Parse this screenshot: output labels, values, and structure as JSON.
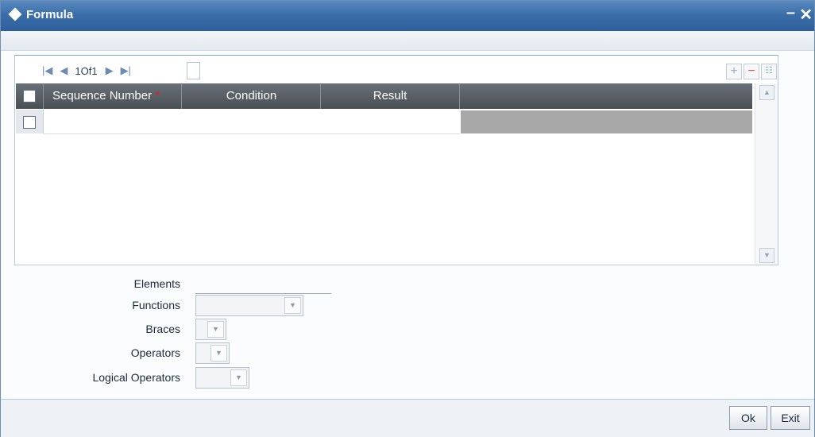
{
  "window": {
    "title": "Formula",
    "minimize_glyph": "–",
    "close_glyph": "✕"
  },
  "pager": {
    "first": "|◀",
    "prev": "◀",
    "page_text": "1Of1",
    "next": "▶",
    "last": "▶|"
  },
  "row_tools": {
    "add": "+",
    "remove": "−",
    "columns": "☷"
  },
  "grid": {
    "columns": [
      "Sequence Number",
      "Condition",
      "Result"
    ],
    "required_marker": "*",
    "rows": [
      {
        "sequence_number": "",
        "condition": "",
        "result": ""
      }
    ]
  },
  "form": {
    "elements_label": "Elements",
    "functions_label": "Functions",
    "braces_label": "Braces",
    "operators_label": "Operators",
    "logical_operators_label": "Logical Operators",
    "elements_value": "",
    "functions_value": "",
    "braces_value": "",
    "operators_value": "",
    "logical_operators_value": ""
  },
  "buttons": {
    "ok": "Ok",
    "exit": "Exit"
  },
  "icons": {
    "title": "diamond-icon",
    "dropdown": "chevron-down-icon",
    "scroll_up": "scroll-up-icon",
    "scroll_down": "scroll-down-icon"
  },
  "colors": {
    "titlebar": "#3b6ea9",
    "grid_header": "#55595e",
    "required": "#e02020",
    "disabled_cell": "#a8a8a8"
  }
}
